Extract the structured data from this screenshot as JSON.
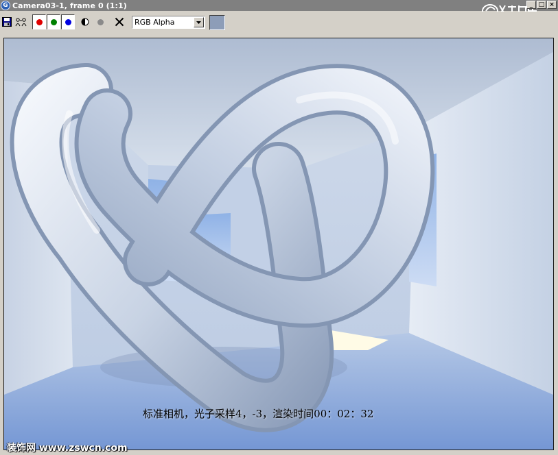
{
  "window": {
    "title": "Camera03-1, frame 0 (1:1)",
    "app_icon_letter": "G",
    "buttons": {
      "minimize": "_",
      "maximize": "□",
      "close": "×"
    }
  },
  "toolbar": {
    "icons": [
      "save-icon",
      "clone-icon",
      "red-channel-icon",
      "green-channel-icon",
      "blue-channel-icon",
      "monochrome-icon",
      "gray-dot-icon",
      "clear-icon"
    ],
    "channel_colors": {
      "red": "#e00000",
      "green": "#008000",
      "blue": "#0000e0"
    },
    "channel_select": {
      "value": "RGB Alpha"
    },
    "swatch_color": "#8d9db8"
  },
  "render": {
    "caption": "标准相机，光子采样4，-3，渲染时间00：02：32"
  },
  "watermark": {
    "site": "装饰网 www.zswcn.com"
  }
}
